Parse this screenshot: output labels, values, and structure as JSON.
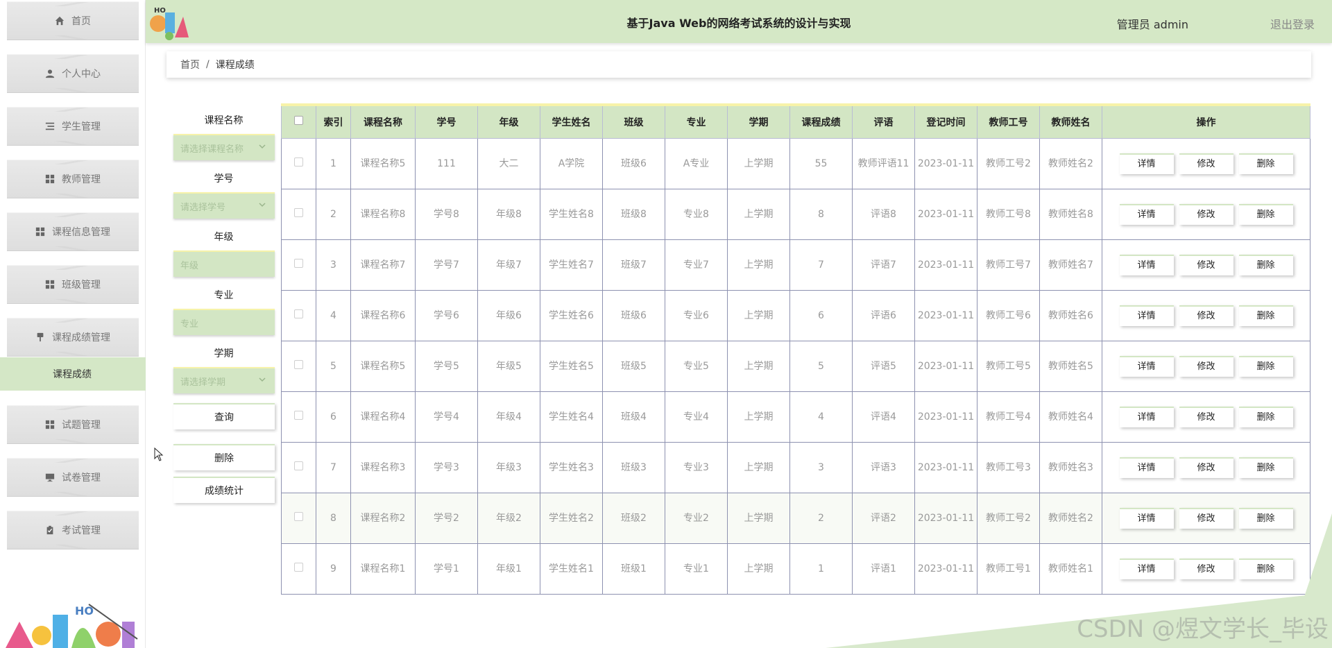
{
  "app": {
    "title": "基于Java Web的网络考试系统的设计与实现",
    "user": "管理员 admin",
    "logout": "退出登录"
  },
  "sidebar": {
    "items": [
      {
        "label": "首页",
        "icon": "home-icon"
      },
      {
        "label": "个人中心",
        "icon": "user-icon"
      },
      {
        "label": "学生管理",
        "icon": "list-icon"
      },
      {
        "label": "教师管理",
        "icon": "grid-icon"
      },
      {
        "label": "课程信息管理",
        "icon": "grid-icon"
      },
      {
        "label": "班级管理",
        "icon": "grid-icon"
      },
      {
        "label": "课程成绩管理",
        "icon": "pin-icon"
      },
      {
        "label": "试题管理",
        "icon": "grid-icon"
      },
      {
        "label": "试卷管理",
        "icon": "monitor-icon"
      },
      {
        "label": "考试管理",
        "icon": "clipboard-icon"
      }
    ],
    "active_sub": "课程成绩"
  },
  "breadcrumb": {
    "home": "首页",
    "separator": "/",
    "current": "课程成绩"
  },
  "search": {
    "course_label": "课程名称",
    "course_placeholder": "请选择课程名称",
    "student_no_label": "学号",
    "student_no_placeholder": "请选择学号",
    "grade_label": "年级",
    "grade_placeholder": "年级",
    "major_label": "专业",
    "major_placeholder": "专业",
    "term_label": "学期",
    "term_placeholder": "请选择学期",
    "query_button": "查询",
    "delete_button": "删除",
    "stats_button": "成绩统计"
  },
  "table": {
    "headers": [
      "索引",
      "课程名称",
      "学号",
      "年级",
      "学生姓名",
      "班级",
      "专业",
      "学期",
      "课程成绩",
      "评语",
      "登记时间",
      "教师工号",
      "教师姓名",
      "操作"
    ],
    "actions": {
      "detail": "详情",
      "edit": "修改",
      "delete": "删除"
    },
    "rows": [
      {
        "idx": "1",
        "course": "课程名称5",
        "sno": "111",
        "grade": "大二",
        "name": "A学院",
        "cls": "班级6",
        "major": "A专业",
        "term": "上学期",
        "score": "55",
        "comment": "教师评语11",
        "time": "2023-01-11",
        "tno": "教师工号2",
        "tname": "教师姓名2"
      },
      {
        "idx": "2",
        "course": "课程名称8",
        "sno": "学号8",
        "grade": "年级8",
        "name": "学生姓名8",
        "cls": "班级8",
        "major": "专业8",
        "term": "上学期",
        "score": "8",
        "comment": "评语8",
        "time": "2023-01-11",
        "tno": "教师工号8",
        "tname": "教师姓名8"
      },
      {
        "idx": "3",
        "course": "课程名称7",
        "sno": "学号7",
        "grade": "年级7",
        "name": "学生姓名7",
        "cls": "班级7",
        "major": "专业7",
        "term": "上学期",
        "score": "7",
        "comment": "评语7",
        "time": "2023-01-11",
        "tno": "教师工号7",
        "tname": "教师姓名7"
      },
      {
        "idx": "4",
        "course": "课程名称6",
        "sno": "学号6",
        "grade": "年级6",
        "name": "学生姓名6",
        "cls": "班级6",
        "major": "专业6",
        "term": "上学期",
        "score": "6",
        "comment": "评语6",
        "time": "2023-01-11",
        "tno": "教师工号6",
        "tname": "教师姓名6"
      },
      {
        "idx": "5",
        "course": "课程名称5",
        "sno": "学号5",
        "grade": "年级5",
        "name": "学生姓名5",
        "cls": "班级5",
        "major": "专业5",
        "term": "上学期",
        "score": "5",
        "comment": "评语5",
        "time": "2023-01-11",
        "tno": "教师工号5",
        "tname": "教师姓名5"
      },
      {
        "idx": "6",
        "course": "课程名称4",
        "sno": "学号4",
        "grade": "年级4",
        "name": "学生姓名4",
        "cls": "班级4",
        "major": "专业4",
        "term": "上学期",
        "score": "4",
        "comment": "评语4",
        "time": "2023-01-11",
        "tno": "教师工号4",
        "tname": "教师姓名4"
      },
      {
        "idx": "7",
        "course": "课程名称3",
        "sno": "学号3",
        "grade": "年级3",
        "name": "学生姓名3",
        "cls": "班级3",
        "major": "专业3",
        "term": "上学期",
        "score": "3",
        "comment": "评语3",
        "time": "2023-01-11",
        "tno": "教师工号3",
        "tname": "教师姓名3"
      },
      {
        "idx": "8",
        "course": "课程名称2",
        "sno": "学号2",
        "grade": "年级2",
        "name": "学生姓名2",
        "cls": "班级2",
        "major": "专业2",
        "term": "上学期",
        "score": "2",
        "comment": "评语2",
        "time": "2023-01-11",
        "tno": "教师工号2",
        "tname": "教师姓名2"
      },
      {
        "idx": "9",
        "course": "课程名称1",
        "sno": "学号1",
        "grade": "年级1",
        "name": "学生姓名1",
        "cls": "班级1",
        "major": "专业1",
        "term": "上学期",
        "score": "1",
        "comment": "评语1",
        "time": "2023-01-11",
        "tno": "教师工号1",
        "tname": "教师姓名1"
      }
    ]
  },
  "watermark": "CSDN @煜文学长_毕设",
  "colors": {
    "accent_green": "#d3e6c4",
    "header_green": "#d5e8c6",
    "accent_yellow": "#f7f3a9"
  }
}
